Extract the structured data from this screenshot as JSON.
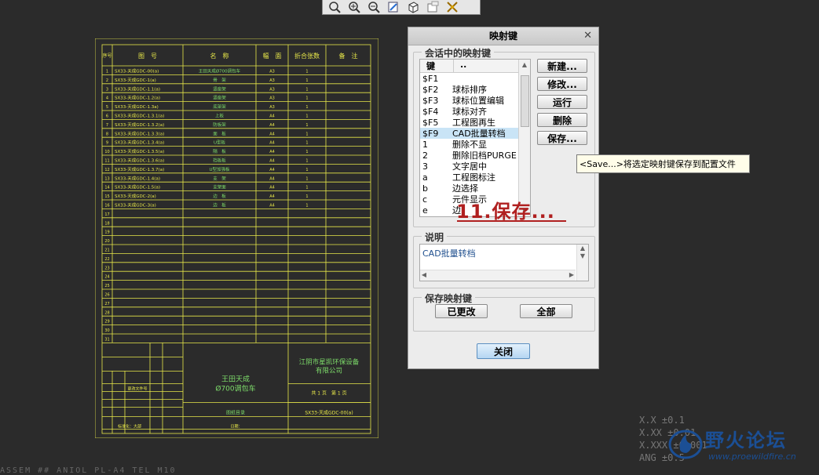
{
  "toolbar": {
    "icons": [
      "zoom-fit-icon",
      "zoom-in-icon",
      "zoom-out-icon",
      "repaint-icon",
      "view-cube-icon",
      "named-view-icon",
      "settings-icon"
    ]
  },
  "drawing": {
    "col_headers": [
      "序号",
      "图　号",
      "名　称",
      "幅　面",
      "折合张数",
      "备　注"
    ],
    "rows": [
      {
        "n": "1",
        "code": "SX33-天成GDC-00(a)",
        "name": "王田天成Ø700调包车",
        "size": "A3",
        "q": "1"
      },
      {
        "n": "2",
        "code": "SX33-天成GDC-1(a)",
        "name": "骨　架",
        "size": "A3",
        "q": "1"
      },
      {
        "n": "3",
        "code": "SX33-天成GDC-1.1(a)",
        "name": "竖座架",
        "size": "A3",
        "q": "1"
      },
      {
        "n": "4",
        "code": "SX33-天成GDC-1.2(a)",
        "name": "竖座架",
        "size": "A3",
        "q": "1"
      },
      {
        "n": "5",
        "code": "SX33-天成GDC-1.3a)",
        "name": "底架架",
        "size": "A3",
        "q": "1"
      },
      {
        "n": "6",
        "code": "SX33-天成GDC-1.3.1(a)",
        "name": "上板",
        "size": "A4",
        "q": "1"
      },
      {
        "n": "7",
        "code": "SX33-天成GDC-1.3.2(a)",
        "name": "防板架",
        "size": "A4",
        "q": "1"
      },
      {
        "n": "8",
        "code": "SX33-天成GDC-1.3.3(a)",
        "name": "面　板",
        "size": "A4",
        "q": "1"
      },
      {
        "n": "9",
        "code": "SX33-天成GDC-1.3.4(a)",
        "name": "U型板",
        "size": "A4",
        "q": "1"
      },
      {
        "n": "10",
        "code": "SX33-天成GDC-1.3.5(a)",
        "name": "隔　板",
        "size": "A4",
        "q": "1"
      },
      {
        "n": "11",
        "code": "SX33-天成GDC-1.3.6(a)",
        "name": "挡板板",
        "size": "A4",
        "q": "1"
      },
      {
        "n": "12",
        "code": "SX33-天成GDC-1.3.7(a)",
        "name": "U型加强板",
        "size": "A4",
        "q": "1"
      },
      {
        "n": "13",
        "code": "SX33-天成GDC-1.4(a)",
        "name": "支　架",
        "size": "A4",
        "q": "1"
      },
      {
        "n": "14",
        "code": "SX33-天成GDC-1.5(a)",
        "name": "支架面",
        "size": "A4",
        "q": "1"
      },
      {
        "n": "15",
        "code": "SX33-天成GDC-2(a)",
        "name": "边　板",
        "size": "A4",
        "q": "1"
      },
      {
        "n": "16",
        "code": "SX33-天成GDC-3(a)",
        "name": "边　板",
        "size": "A4",
        "q": "1"
      }
    ],
    "empty_row_numbers": [
      "17",
      "18",
      "19",
      "20",
      "21",
      "22",
      "23",
      "24",
      "25",
      "26",
      "27",
      "28",
      "29",
      "30",
      "31"
    ],
    "title_block": {
      "product_line1": "王田天成",
      "product_line2": "Ø700调包车",
      "company_line1": "江阴市星凯环保设备",
      "company_line2": "有限公司",
      "sheet_info": "共 1 页　第 1 页",
      "doc_name": "图纸目录",
      "doc_code": "SX33-天成GDC-00(a)",
      "mark_label": "更改文件号",
      "bottom_left": "标准化：大部",
      "bottom_mid": "日期："
    }
  },
  "dialog": {
    "title": "映射键",
    "session_group_label": "会话中的映射键",
    "list_header_key": "键",
    "list_header_name": "..",
    "items": [
      {
        "key": "$F1",
        "name": ""
      },
      {
        "key": "$F2",
        "name": "球标排序"
      },
      {
        "key": "$F3",
        "name": "球标位置编辑"
      },
      {
        "key": "$F4",
        "name": "球标对齐"
      },
      {
        "key": "$F5",
        "name": "工程图再生"
      },
      {
        "key": "$F9",
        "name": "CAD批量转档"
      },
      {
        "key": "1",
        "name": "删除不显"
      },
      {
        "key": "2",
        "name": "删除旧档PURGE"
      },
      {
        "key": "3",
        "name": "文字居中"
      },
      {
        "key": "a",
        "name": "工程图标注"
      },
      {
        "key": "b",
        "name": "边选择"
      },
      {
        "key": "c",
        "name": "元件显示"
      },
      {
        "key": "e",
        "name": "边"
      }
    ],
    "selected_index": 5,
    "buttons": {
      "new": "新建...",
      "modify": "修改...",
      "run": "运行",
      "delete": "删除",
      "save": "保存..."
    },
    "description_group_label": "说明",
    "description_text": "CAD批量转档",
    "save_group_label": "保存映射键",
    "save_changed": "已更改",
    "save_all": "全部",
    "close": "关闭"
  },
  "tooltip": "<Save...>将选定映射键保存到配置文件",
  "annotation": "11.保存...",
  "coords": [
    "X.X  ±0.1",
    "X.XX ±0.01",
    "X.XXX ±0.001",
    "ANG  ±0.5"
  ],
  "cmdline": "ASSEM  ##  ANIOL  PL-A4  TEL  M10",
  "watermark": {
    "text": "野火论坛",
    "url": "www.proewildfire.cn"
  },
  "colors": {
    "drawing_line": "#e8e84a",
    "drawing_text_green": "#7ddc6a",
    "selection": "#c9e4f6",
    "annotation": "#b02020"
  }
}
